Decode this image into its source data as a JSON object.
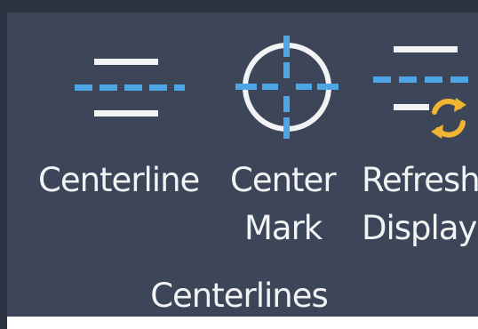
{
  "ribbon": {
    "panel_title": "Centerlines",
    "tools": [
      {
        "label": "Centerline",
        "icon": "centerline-icon"
      },
      {
        "label_line1": "Center",
        "label_line2": "Mark",
        "icon": "center-mark-icon"
      },
      {
        "label_line1": "Refresh",
        "label_line2": "Display",
        "icon": "refresh-display-icon"
      }
    ]
  },
  "colors": {
    "panel_bg": "#3c4658",
    "accent_blue": "#4ea6e6",
    "icon_white": "#f2f3f5",
    "refresh_orange": "#f2b531"
  }
}
